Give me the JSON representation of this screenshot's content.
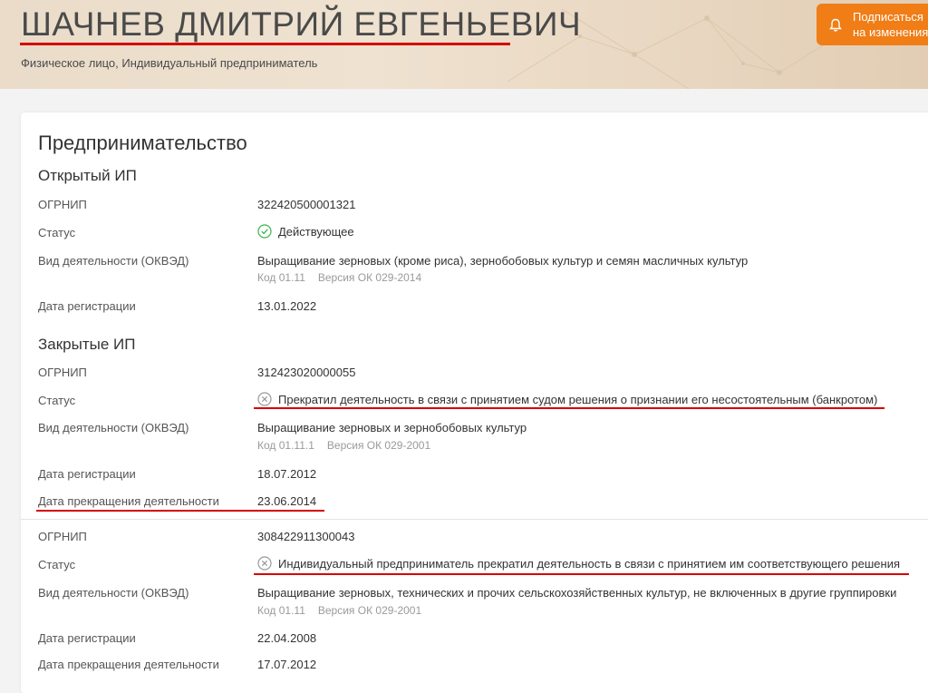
{
  "header": {
    "name": "ШАЧНЕВ ДМИТРИЙ ЕВГЕНЬЕВИЧ",
    "subtitle": "Физическое лицо, Индивидуальный предприниматель",
    "subscribe_line1": "Подписаться",
    "subscribe_line2": "на изменения",
    "accent_color": "#f07d16",
    "icon": "bell-icon"
  },
  "section": {
    "title": "Предпринимательство",
    "open_title": "Открытый ИП",
    "closed_title": "Закрытые ИП"
  },
  "labels": {
    "ogrnip": "ОГРНИП",
    "status": "Статус",
    "okved": "Вид деятельности (ОКВЭД)",
    "reg_date": "Дата регистрации",
    "end_date": "Дата прекращения деятельности"
  },
  "open_ip": {
    "ogrnip": "322420500001321",
    "status": "Действующее",
    "status_icon": "check-circle-icon",
    "okved_name": "Выращивание зерновых (кроме риса), зернобобовых культур и семян масличных культур",
    "okved_code": "Код 01.11",
    "okved_version": "Версия ОК 029-2014",
    "reg_date": "13.01.2022"
  },
  "closed_ip": [
    {
      "ogrnip": "312423020000055",
      "status": "Прекратил деятельность в связи с принятием судом решения о признании его несостоятельным (банкротом)",
      "status_icon": "x-circle-icon",
      "okved_name": "Выращивание зерновых и зернобобовых культур",
      "okved_code": "Код 01.11.1",
      "okved_version": "Версия ОК 029-2001",
      "reg_date": "18.07.2012",
      "end_date": "23.06.2014"
    },
    {
      "ogrnip": "308422911300043",
      "status": "Индивидуальный предприниматель прекратил деятельность в связи с принятием им соответствующего решения",
      "status_icon": "x-circle-icon",
      "okved_name": "Выращивание зерновых, технических и прочих сельскохозяйственных культур, не включенных в другие группировки",
      "okved_code": "Код 01.11",
      "okved_version": "Версия ОК 029-2001",
      "reg_date": "22.04.2008",
      "end_date": "17.07.2012"
    }
  ],
  "colors": {
    "annotation_underline": "#d40000",
    "active_status": "#3cb44b",
    "closed_status": "#999999"
  }
}
